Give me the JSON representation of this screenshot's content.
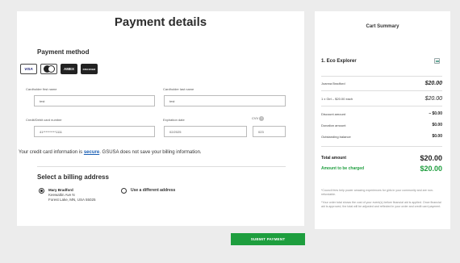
{
  "payment": {
    "title": "Payment details",
    "method_title": "Payment method",
    "cards": [
      {
        "name": "visa-icon",
        "label": "VISA"
      },
      {
        "name": "mastercard-icon",
        "label": ""
      },
      {
        "name": "amex-icon",
        "label": "AMEX"
      },
      {
        "name": "discover-icon",
        "label": "DISCOVER"
      }
    ],
    "first_name": {
      "label": "Cardholder first name",
      "value": "test"
    },
    "last_name": {
      "label": "Cardholder last name",
      "value": "test"
    },
    "card_number": {
      "label": "Credit/Debit card number",
      "value": "41**********1111"
    },
    "expiration": {
      "label": "Expiration date",
      "value": "02/2025"
    },
    "cvv": {
      "label": "CVV",
      "value": "023"
    },
    "secure_prefix": "Your credit card information is ",
    "secure_link": "secure",
    "secure_suffix": ". GSUSA does not save your billing information.",
    "billing_title": "Select a billing address",
    "address": {
      "name": "Mary Bradford",
      "street": "Keewaltin Ave N",
      "city": "Forest Lake, MN, USA 55025"
    },
    "different_address": "Use a different address",
    "submit_label": "SUBMIT PAYMENT"
  },
  "cart": {
    "title": "Cart Summary",
    "product": "1. Eco Explorer",
    "person": "Joanna Bradford",
    "person_price": "$20.00",
    "item_line": "1 x Girl – $20.00 each",
    "item_price": "$20.00",
    "discount_label": "Discount amount",
    "discount_value": "– $0.00",
    "donation_label": "Donation amount",
    "donation_value": "$0.00",
    "outstanding_label": "Outstanding balance",
    "outstanding_value": "$0.00",
    "total_label": "Total amount",
    "total_value": "$20.00",
    "charged_label": "Amount to be charged",
    "charged_value": "$20.00",
    "note1": "*Council fees help power amazing experiences for girls in your community and are non-refundable.",
    "note2": "*Your order total shows the cost of your event(s) before financial aid is applied. Once financial aid is approved, the total will be adjusted and reflected in your order and credit card payment."
  },
  "colors": {
    "accent": "#1e9e3e",
    "link": "#1a5fb4"
  }
}
